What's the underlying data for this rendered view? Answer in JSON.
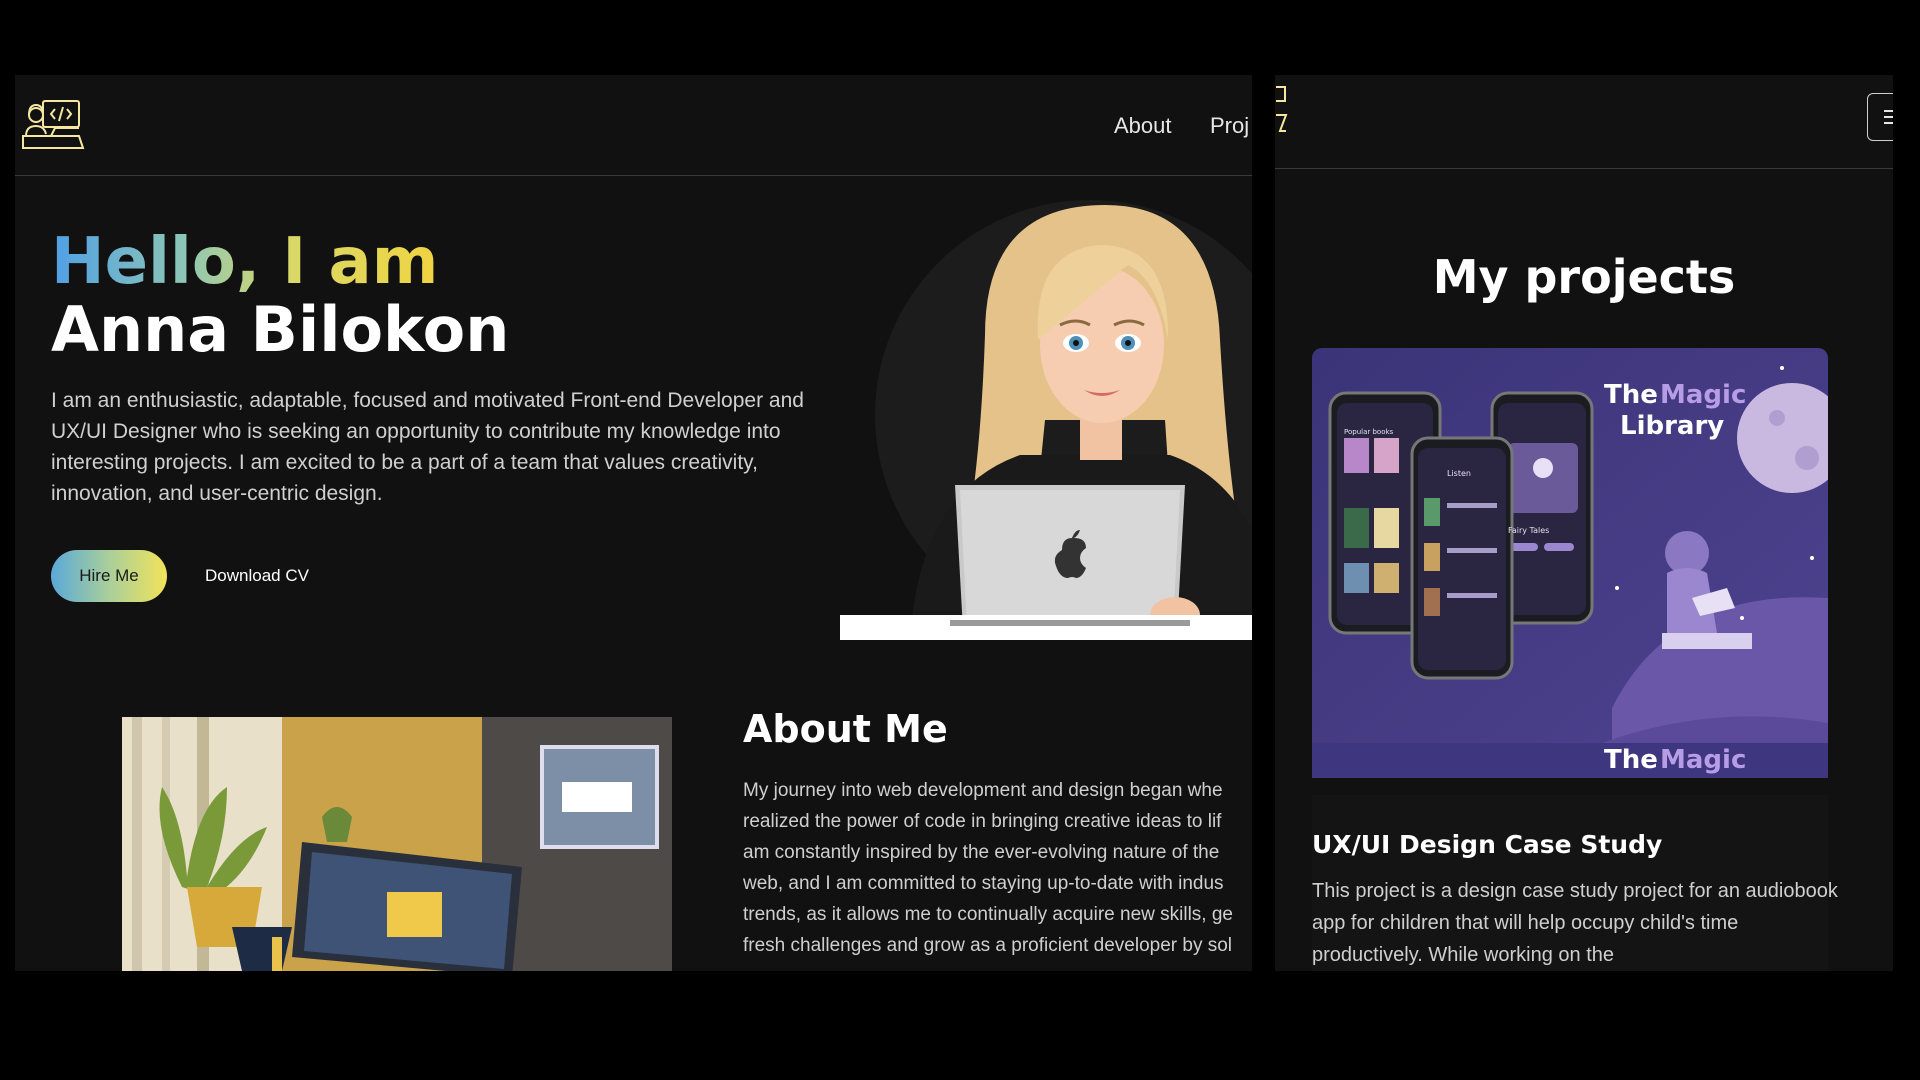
{
  "left": {
    "nav": {
      "links": [
        "About",
        "Proj"
      ]
    },
    "hero": {
      "line1": "Hello, I am",
      "line2": "Anna Bilokon",
      "description": "I am an enthusiastic, adaptable, focused and motivated Front-end Developer and UX/UI Designer who is seeking an opportunity to contribute my knowledge into interesting projects. I am excited to be a part of a team that values creativity, innovation, and user-centric design.",
      "hire_label": "Hire Me",
      "cv_label": "Download CV"
    },
    "about": {
      "title": "About Me",
      "lines": [
        "My journey into web development and design began whe",
        "realized the power of code in bringing creative ideas to lif",
        "am constantly inspired by the ever-evolving nature of the",
        "web, and I am committed to staying up-to-date with indus",
        "trends, as it allows me to continually acquire new skills, ge",
        "fresh challenges and grow as a proficient developer by sol"
      ]
    }
  },
  "right": {
    "menu_icon": "hamburger-icon",
    "projects": {
      "title": "My projects",
      "card_image": {
        "title_word1": "The",
        "title_word2": "Magic",
        "title_word3": "Library",
        "repeat_word1": "The",
        "repeat_word2": "Magic",
        "phone_label_popular": "Popular books",
        "phone_label_listen": "Listen",
        "phone_label_fairy": "Fairy Tales"
      },
      "card_title": "UX/UI Design Case Study",
      "card_desc": "This project is a design case study project for an audiobook app for children that will help occupy child's time productively. While working on the"
    }
  },
  "colors": {
    "background": "#111111",
    "gradient_start": "#4f9fe6",
    "gradient_end": "#f0d441",
    "card_purple": "#4b3f8c"
  }
}
